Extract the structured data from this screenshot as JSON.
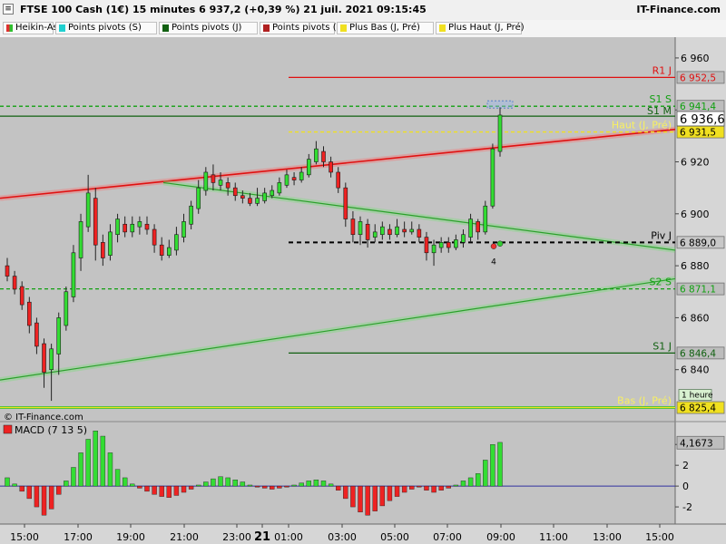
{
  "window": {
    "title": "FTSE 100 Cash (1€) 15 minutes 6 937,2 (+0,39 %) 21 juil. 2021 09:15:45",
    "brand": "IT-Finance.com",
    "menu_glyph": "≡"
  },
  "legend": [
    {
      "label": "Heikin-Ashi",
      "color": "#e03030",
      "color2": "#30c030"
    },
    {
      "label": "Points pivots (S)",
      "color": "#20d0d0"
    },
    {
      "label": "Points pivots (J)",
      "color": "#106010"
    },
    {
      "label": "Points pivots (M)",
      "color": "#b02020"
    },
    {
      "label": "Plus Bas (J, Pré)",
      "color": "#f0e020"
    },
    {
      "label": "Plus Haut (J, Pré)",
      "color": "#f0e020"
    }
  ],
  "chart_data": {
    "type": "candlestick",
    "title": "FTSE 100 Cash (1€) 15 minutes",
    "last_price": "6 936,6",
    "y_axis": {
      "ticks": [
        "6 960",
        "6 940",
        "6 920",
        "6 900",
        "6 880",
        "6 860",
        "6 840"
      ],
      "range": [
        6820,
        6968
      ]
    },
    "x_axis": {
      "ticks": [
        "15:00",
        "17:00",
        "19:00",
        "21:00",
        "23:00",
        "21",
        "01:00",
        "03:00",
        "05:00",
        "07:00",
        "09:00",
        "11:00",
        "13:00",
        "15:00"
      ]
    },
    "watermark": "© IT-Finance.com",
    "candles": [
      {
        "o": 6880,
        "c": 6876,
        "h": 6883,
        "l": 6874
      },
      {
        "o": 6876,
        "c": 6871,
        "h": 6878,
        "l": 6869
      },
      {
        "o": 6872,
        "c": 6865,
        "h": 6874,
        "l": 6863
      },
      {
        "o": 6866,
        "c": 6857,
        "h": 6868,
        "l": 6854
      },
      {
        "o": 6858,
        "c": 6849,
        "h": 6860,
        "l": 6846
      },
      {
        "o": 6850,
        "c": 6839,
        "h": 6852,
        "l": 6833
      },
      {
        "o": 6840,
        "c": 6848,
        "h": 6850,
        "l": 6828
      },
      {
        "o": 6846,
        "c": 6860,
        "h": 6862,
        "l": 6838
      },
      {
        "o": 6857,
        "c": 6870,
        "h": 6872,
        "l": 6855
      },
      {
        "o": 6868,
        "c": 6885,
        "h": 6888,
        "l": 6866
      },
      {
        "o": 6883,
        "c": 6897,
        "h": 6900,
        "l": 6878
      },
      {
        "o": 6895,
        "c": 6908,
        "h": 6915,
        "l": 6893
      },
      {
        "o": 6906,
        "c": 6888,
        "h": 6910,
        "l": 6882
      },
      {
        "o": 6889,
        "c": 6883,
        "h": 6892,
        "l": 6880
      },
      {
        "o": 6884,
        "c": 6893,
        "h": 6896,
        "l": 6882
      },
      {
        "o": 6892,
        "c": 6898,
        "h": 6900,
        "l": 6889
      },
      {
        "o": 6896,
        "c": 6893,
        "h": 6899,
        "l": 6891
      },
      {
        "o": 6893,
        "c": 6896,
        "h": 6899,
        "l": 6891
      },
      {
        "o": 6895,
        "c": 6897,
        "h": 6899,
        "l": 6892
      },
      {
        "o": 6896,
        "c": 6894,
        "h": 6899,
        "l": 6892
      },
      {
        "o": 6894,
        "c": 6888,
        "h": 6896,
        "l": 6885
      },
      {
        "o": 6888,
        "c": 6884,
        "h": 6891,
        "l": 6882
      },
      {
        "o": 6884,
        "c": 6887,
        "h": 6890,
        "l": 6883
      },
      {
        "o": 6886,
        "c": 6892,
        "h": 6895,
        "l": 6884
      },
      {
        "o": 6891,
        "c": 6897,
        "h": 6900,
        "l": 6889
      },
      {
        "o": 6896,
        "c": 6903,
        "h": 6905,
        "l": 6894
      },
      {
        "o": 6902,
        "c": 6910,
        "h": 6913,
        "l": 6900
      },
      {
        "o": 6909,
        "c": 6916,
        "h": 6918,
        "l": 6907
      },
      {
        "o": 6915,
        "c": 6912,
        "h": 6919,
        "l": 6909
      },
      {
        "o": 6911,
        "c": 6913,
        "h": 6916,
        "l": 6909
      },
      {
        "o": 6912,
        "c": 6910,
        "h": 6914,
        "l": 6907
      },
      {
        "o": 6910,
        "c": 6907,
        "h": 6912,
        "l": 6905
      },
      {
        "o": 6907,
        "c": 6906,
        "h": 6909,
        "l": 6904
      },
      {
        "o": 6906,
        "c": 6904,
        "h": 6908,
        "l": 6903
      },
      {
        "o": 6904,
        "c": 6906,
        "h": 6910,
        "l": 6903
      },
      {
        "o": 6905,
        "c": 6908,
        "h": 6910,
        "l": 6904
      },
      {
        "o": 6907,
        "c": 6909,
        "h": 6911,
        "l": 6906
      },
      {
        "o": 6908,
        "c": 6912,
        "h": 6914,
        "l": 6907
      },
      {
        "o": 6911,
        "c": 6915,
        "h": 6917,
        "l": 6910
      },
      {
        "o": 6914,
        "c": 6913,
        "h": 6916,
        "l": 6911
      },
      {
        "o": 6913,
        "c": 6916,
        "h": 6918,
        "l": 6912
      },
      {
        "o": 6915,
        "c": 6921,
        "h": 6923,
        "l": 6914
      },
      {
        "o": 6920,
        "c": 6925,
        "h": 6928,
        "l": 6919
      },
      {
        "o": 6924,
        "c": 6920,
        "h": 6926,
        "l": 6918
      },
      {
        "o": 6920,
        "c": 6916,
        "h": 6922,
        "l": 6914
      },
      {
        "o": 6916,
        "c": 6910,
        "h": 6918,
        "l": 6908
      },
      {
        "o": 6910,
        "c": 6898,
        "h": 6912,
        "l": 6895
      },
      {
        "o": 6898,
        "c": 6892,
        "h": 6901,
        "l": 6889
      },
      {
        "o": 6892,
        "c": 6897,
        "h": 6899,
        "l": 6888
      },
      {
        "o": 6896,
        "c": 6890,
        "h": 6898,
        "l": 6887
      },
      {
        "o": 6891,
        "c": 6893,
        "h": 6896,
        "l": 6889
      },
      {
        "o": 6892,
        "c": 6895,
        "h": 6897,
        "l": 6890
      },
      {
        "o": 6894,
        "c": 6892,
        "h": 6896,
        "l": 6890
      },
      {
        "o": 6892,
        "c": 6895,
        "h": 6898,
        "l": 6891
      },
      {
        "o": 6894,
        "c": 6893,
        "h": 6897,
        "l": 6891
      },
      {
        "o": 6893,
        "c": 6894,
        "h": 6897,
        "l": 6892
      },
      {
        "o": 6894,
        "c": 6891,
        "h": 6896,
        "l": 6889
      },
      {
        "o": 6891,
        "c": 6885,
        "h": 6893,
        "l": 6882
      },
      {
        "o": 6885,
        "c": 6888,
        "h": 6890,
        "l": 6880
      },
      {
        "o": 6887,
        "c": 6889,
        "h": 6891,
        "l": 6885
      },
      {
        "o": 6889,
        "c": 6887,
        "h": 6891,
        "l": 6885
      },
      {
        "o": 6887,
        "c": 6890,
        "h": 6892,
        "l": 6886
      },
      {
        "o": 6889,
        "c": 6892,
        "h": 6894,
        "l": 6887
      },
      {
        "o": 6891,
        "c": 6898,
        "h": 6900,
        "l": 6889
      },
      {
        "o": 6897,
        "c": 6893,
        "h": 6898,
        "l": 6890
      },
      {
        "o": 6893,
        "c": 6903,
        "h": 6905,
        "l": 6892
      },
      {
        "o": 6903,
        "c": 6925,
        "h": 6927,
        "l": 6902
      },
      {
        "o": 6924,
        "c": 6938,
        "h": 6941,
        "l": 6922
      }
    ],
    "levels": [
      {
        "label": "R1 J",
        "value": 6952.5,
        "value_text": "6 952,5",
        "color": "#e01010",
        "style": "solid"
      },
      {
        "label": "S1 S",
        "value": 6941.4,
        "value_text": "6 941,4",
        "color": "#10a010",
        "style": "dashed"
      },
      {
        "label": "S1 M",
        "value": 6937.6,
        "value_text": "",
        "color": "#106010",
        "style": "solid"
      },
      {
        "label": "Haut (J, Pré)",
        "value": 6931.5,
        "value_text": "6 931,5",
        "color": "#f0e020",
        "style": "dashed"
      },
      {
        "label": "Piv J",
        "value": 6889.0,
        "value_text": "6 889,0",
        "color": "#000000",
        "style": "dashed"
      },
      {
        "label": "S2 S",
        "value": 6871.1,
        "value_text": "6 871,1",
        "color": "#10a010",
        "style": "dashed"
      },
      {
        "label": "S1 J",
        "value": 6846.4,
        "value_text": "6 846,4",
        "color": "#106010",
        "style": "solid"
      },
      {
        "label": "Bas (J, Pré)",
        "value": 6825.4,
        "value_text": "6 825,4",
        "color": "#f0e020",
        "style": "solid"
      }
    ],
    "badge_label": "1 heure",
    "signal_count": "4",
    "macd": {
      "label": "MACD (7 13 5)",
      "last_value": "4,1673",
      "ticks": [
        "4",
        "2",
        "0",
        "-2"
      ],
      "range": [
        -3.3,
        5.5
      ],
      "values": [
        0.8,
        0.2,
        -0.5,
        -1.2,
        -2.0,
        -2.8,
        -2.2,
        -0.8,
        0.5,
        1.8,
        3.2,
        4.5,
        5.3,
        4.8,
        3.2,
        1.6,
        0.8,
        0.2,
        -0.2,
        -0.5,
        -0.8,
        -1.0,
        -1.1,
        -0.9,
        -0.6,
        -0.3,
        0.1,
        0.4,
        0.7,
        0.9,
        0.8,
        0.6,
        0.4,
        0.1,
        -0.1,
        -0.2,
        -0.3,
        -0.2,
        -0.1,
        0.1,
        0.3,
        0.5,
        0.6,
        0.5,
        0.2,
        -0.4,
        -1.2,
        -2.0,
        -2.5,
        -2.8,
        -2.4,
        -1.9,
        -1.4,
        -1.0,
        -0.6,
        -0.3,
        -0.1,
        -0.4,
        -0.6,
        -0.4,
        -0.2,
        0.1,
        0.5,
        0.8,
        1.2,
        2.5,
        4.0,
        4.2
      ]
    }
  }
}
